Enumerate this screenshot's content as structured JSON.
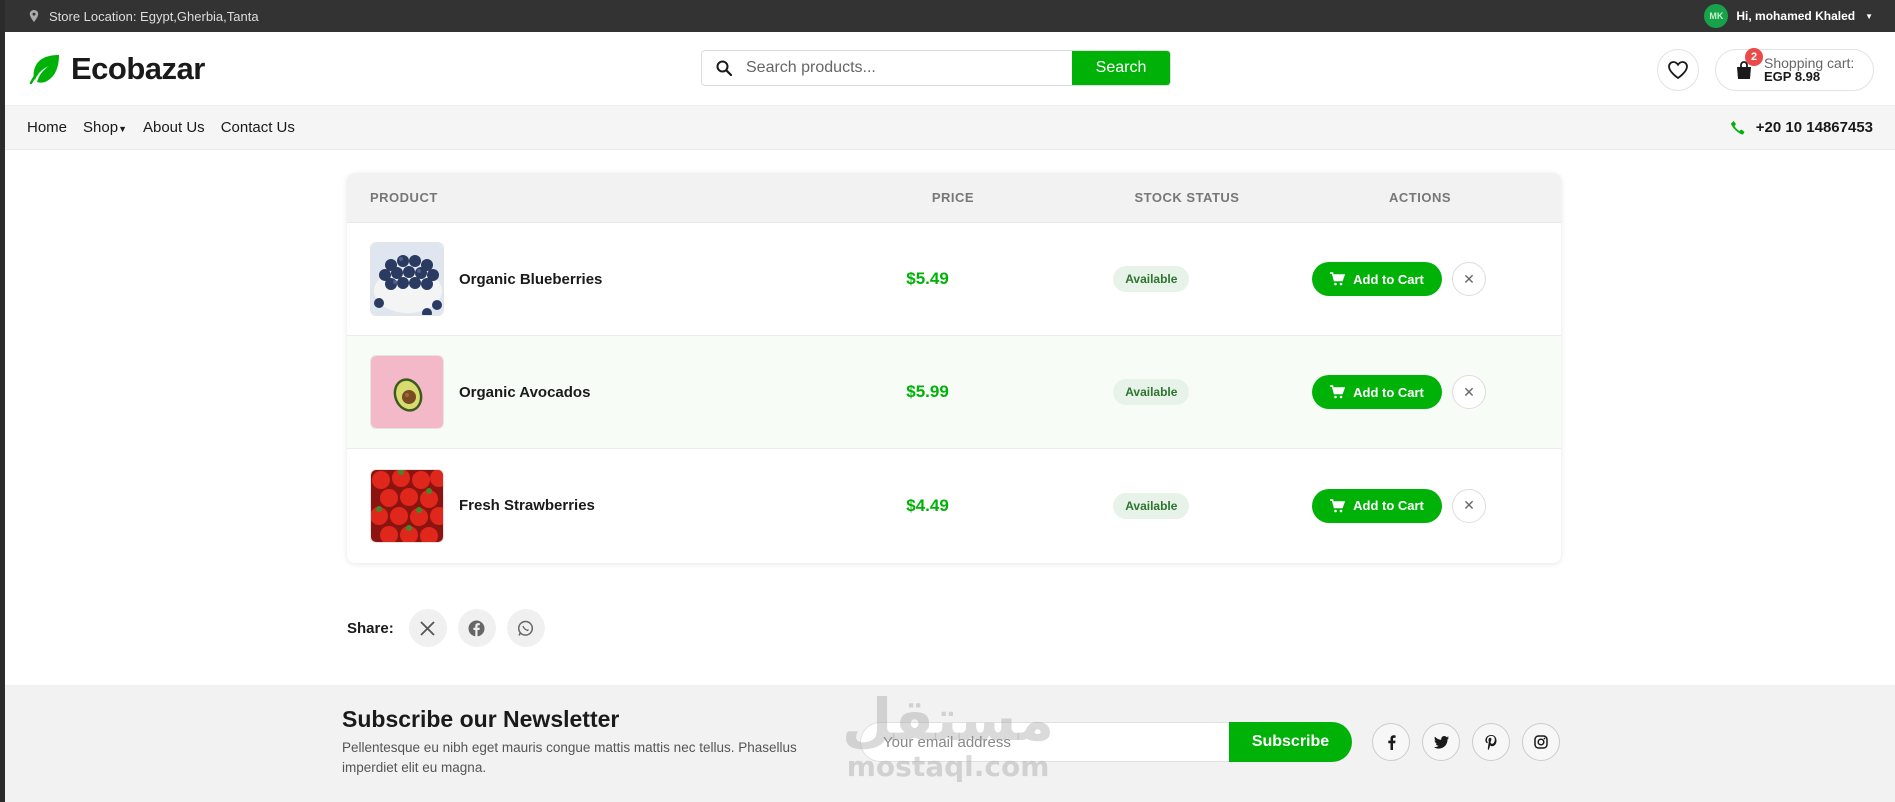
{
  "topbar": {
    "location": "Store Location: Egypt,Gherbia,Tanta",
    "avatar_initials": "MK",
    "greeting": "Hi, mohamed Khaled"
  },
  "header": {
    "logo": "Ecobazar",
    "search_placeholder": "Search products...",
    "search_button": "Search",
    "cart_badge": "2",
    "cart_label": "Shopping cart:",
    "cart_total": "EGP 8.98"
  },
  "nav": {
    "items": [
      "Home",
      "Shop",
      "About Us",
      "Contact Us"
    ],
    "phone": "+20 10 14867453"
  },
  "table": {
    "headers": [
      "PRODUCT",
      "PRICE",
      "STOCK STATUS",
      "ACTIONS"
    ],
    "rows": [
      {
        "name": "Organic Blueberries",
        "price": "$5.49",
        "stock": "Available",
        "action": "Add to Cart"
      },
      {
        "name": "Organic Avocados",
        "price": "$5.99",
        "stock": "Available",
        "action": "Add to Cart"
      },
      {
        "name": "Fresh Strawberries",
        "price": "$4.49",
        "stock": "Available",
        "action": "Add to Cart"
      }
    ]
  },
  "share": {
    "label": "Share:"
  },
  "newsletter": {
    "title": "Subscribe our Newsletter",
    "text": "Pellentesque eu nibh eget mauris congue mattis mattis nec tellus. Phasellus imperdiet elit eu magna.",
    "placeholder": "Your email address",
    "button": "Subscribe"
  },
  "watermark": {
    "arabic": "مستقل",
    "latin": "mostaql.com"
  },
  "colors": {
    "brand": "#00b207",
    "badge": "#ea4b48",
    "topbar": "#333333"
  }
}
